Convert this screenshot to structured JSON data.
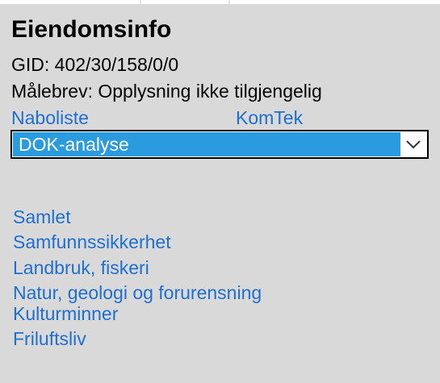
{
  "property": {
    "title": "Eiendomsinfo",
    "gid": "GID: 402/30/158/0/0",
    "maalebrev": "Målebrev: Opplysning ikke tilgjengelig"
  },
  "links": {
    "naboliste": "Naboliste",
    "komtek": "KomTek"
  },
  "dropdown": {
    "selected": "DOK-analyse",
    "icon": "chevron-down-icon"
  },
  "categories": [
    "Samlet",
    "Samfunnssikkerhet",
    "Landbruk, fiskeri",
    "Natur, geologi og forurensning",
    "Kulturminner",
    "Friluftsliv"
  ],
  "colors": {
    "panel_bg": "#d9d9d9",
    "link": "#1f6fd1",
    "select_highlight": "#2a9bde"
  }
}
